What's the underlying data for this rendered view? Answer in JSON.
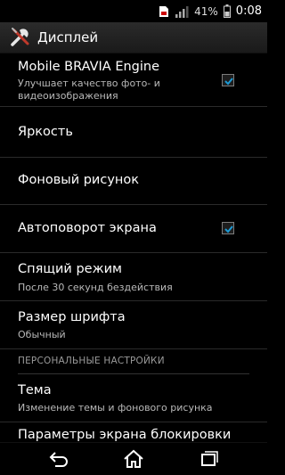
{
  "status_bar": {
    "battery_percent": "41%",
    "time": "0:08",
    "icons": [
      "sim-icon",
      "signal-icon",
      "battery-icon"
    ]
  },
  "action_bar": {
    "icon": "tools-icon",
    "title": "Дисплей"
  },
  "items": [
    {
      "title": "Mobile BRAVIA Engine",
      "subtitle": "Улучшает качество фото- и видеоизображения",
      "checked": true
    },
    {
      "title": "Яркость"
    },
    {
      "title": "Фоновый рисунок"
    },
    {
      "title": "Автоповорот экрана",
      "checked": true
    },
    {
      "title": "Спящий режим",
      "subtitle": "После 30 секунд бездействия"
    },
    {
      "title": "Размер шрифта",
      "subtitle": "Обычный"
    }
  ],
  "section_personal": {
    "header": "ПЕРСОНАЛЬНЫЕ НАСТРОЙКИ",
    "items": [
      {
        "title": "Тема",
        "subtitle": "Изменение темы и фонового рисунка"
      },
      {
        "title": "Параметры экрана блокировки"
      }
    ]
  },
  "nav_bar": {
    "buttons": [
      "back-icon",
      "home-icon",
      "recent-apps-icon"
    ]
  },
  "colors": {
    "accent": "#1c9bd6",
    "background": "#000000",
    "subtitle_text": "#b9b9b9"
  }
}
